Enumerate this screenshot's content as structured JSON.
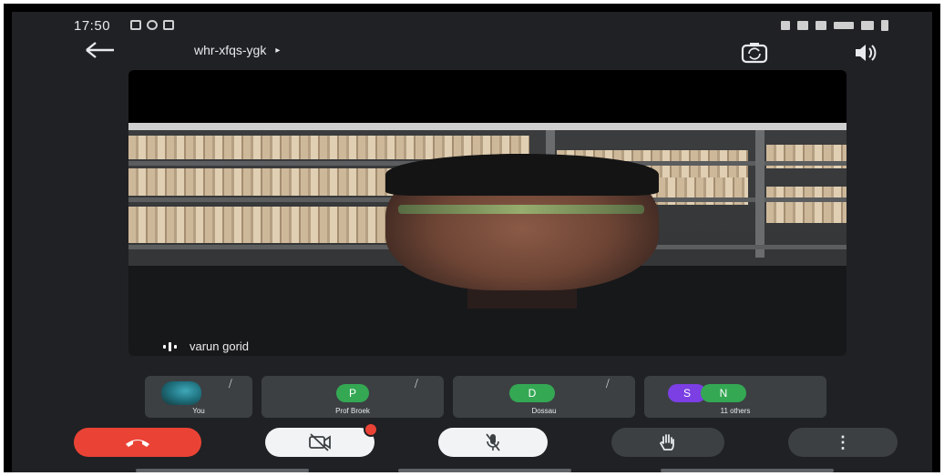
{
  "status_bar": {
    "time": "17:50"
  },
  "header": {
    "meeting_code": "whr-xfqs-ygk",
    "chevron": "▸"
  },
  "main_video": {
    "participant_name": "varun gorid"
  },
  "tiles": [
    {
      "avatar_letter": "",
      "name": "You",
      "mic": "muted"
    },
    {
      "avatar_letter": "P",
      "name": "Prof Broek",
      "mic": "muted",
      "color": "#34a853"
    },
    {
      "avatar_letter": "D",
      "name": "Dossau",
      "mic": "muted",
      "color": "#34a853"
    },
    {
      "avatar_letters": [
        "S",
        "N"
      ],
      "name": "11 others",
      "colors": [
        "#7b3fe4",
        "#34a853"
      ]
    }
  ],
  "controls": {
    "end_call_color": "#ea4335",
    "camera": "camera-off",
    "mic": "mic-off",
    "raise_hand": "raise-hand",
    "more": "⋮"
  },
  "colors": {
    "background": "#202124",
    "tile": "#3c4043",
    "text": "#e8eaed"
  }
}
